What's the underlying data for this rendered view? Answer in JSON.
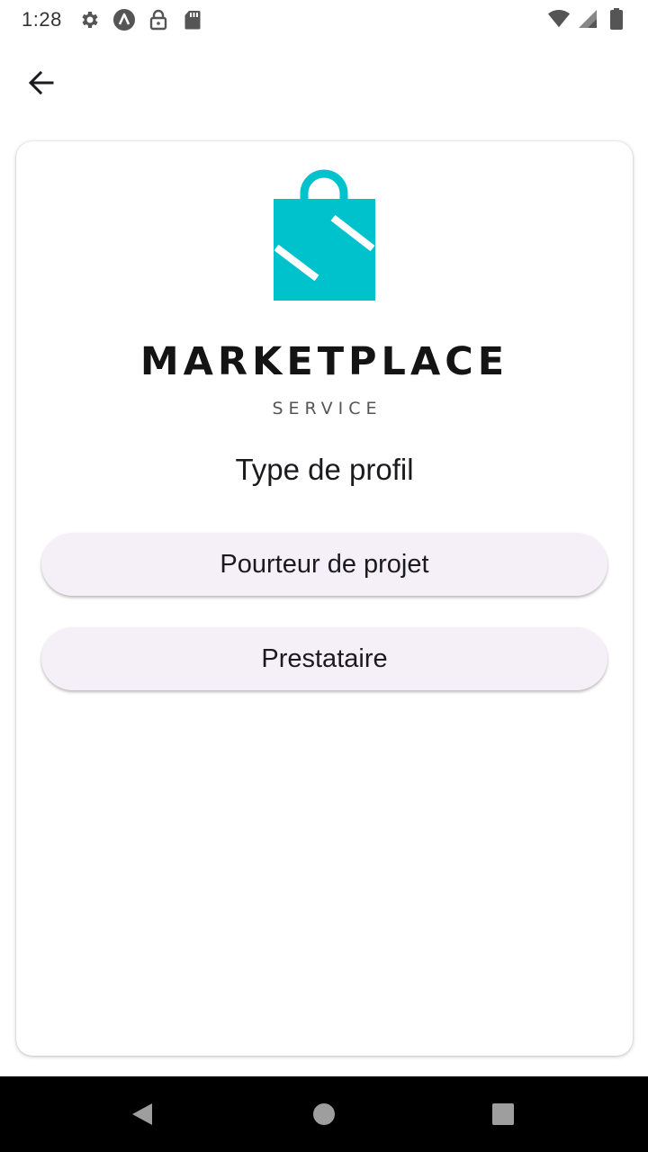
{
  "status_bar": {
    "time": "1:28",
    "icons_left": [
      "gear-icon",
      "a-badge-icon",
      "lock-icon",
      "sd-card-icon"
    ],
    "icons_right": [
      "wifi-icon",
      "signal-icon",
      "battery-icon"
    ]
  },
  "app_bar": {
    "back_icon": "arrow-left-icon"
  },
  "logo": {
    "title": "MARKETPLACE",
    "subtitle": "SERVICE",
    "brand_color": "#00C2CC"
  },
  "profile": {
    "title": "Type de profil",
    "options": [
      {
        "label": "Pourteur de projet"
      },
      {
        "label": "Prestataire"
      }
    ]
  },
  "nav_bar": {
    "icons": [
      "nav-back-icon",
      "nav-home-icon",
      "nav-recents-icon"
    ]
  }
}
